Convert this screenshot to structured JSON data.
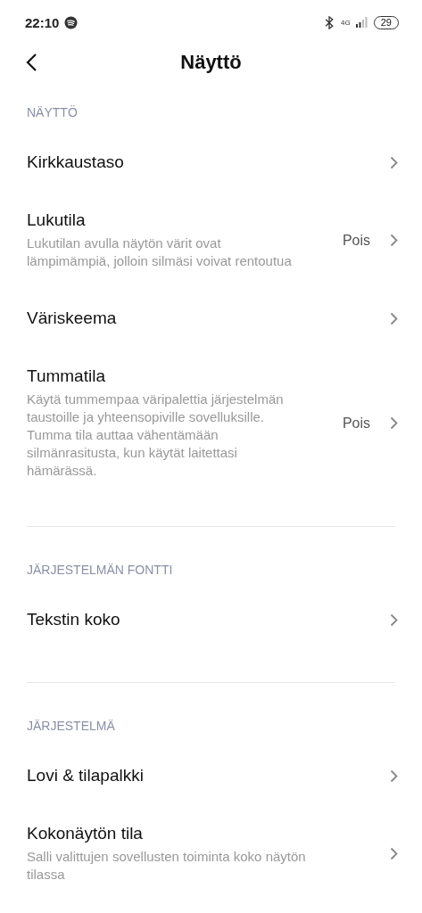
{
  "status_bar": {
    "time": "22:10",
    "network": "4G",
    "battery": "29"
  },
  "header": {
    "title": "Näyttö"
  },
  "sections": [
    {
      "title": "NÄYTTÖ",
      "divider": false,
      "items": [
        {
          "title": "Kirkkaustaso"
        },
        {
          "title": "Lukutila",
          "description": "Lukutilan avulla näytön värit ovat lämpimämpiä, jolloin silmäsi voivat rentoutua",
          "value": "Pois"
        },
        {
          "title": "Väriskeema"
        },
        {
          "title": "Tummatila",
          "description": "Käytä tummempaa väripalettia järjestelmän taustoille ja yhteensopiville sovelluksille. Tumma tila auttaa vähentämään silmänrasitusta, kun käytät laitettasi hämärässä.",
          "value": "Pois"
        }
      ]
    },
    {
      "title": "JÄRJESTELMÄN FONTTI",
      "divider": true,
      "items": [
        {
          "title": "Tekstin koko"
        }
      ]
    },
    {
      "title": "JÄRJESTELMÄ",
      "divider": true,
      "items": [
        {
          "title": "Lovi & tilapalkki"
        },
        {
          "title": "Kokonäytön tila",
          "description": "Salli valittujen sovellusten toiminta koko näytön tilassa"
        }
      ]
    }
  ]
}
